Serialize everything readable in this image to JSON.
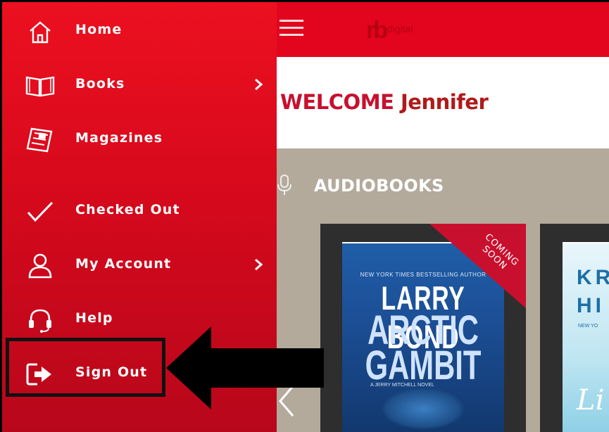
{
  "header": {
    "logo_mark": "rb",
    "logo_text": "digital"
  },
  "welcome": {
    "prefix": "WELCOME",
    "name": "Jennifer"
  },
  "section": {
    "title": "AUDIOBOOKS",
    "icon": "microphone-icon"
  },
  "books": [
    {
      "top_line": "NEW YORK TIMES BESTSELLING AUTHOR",
      "author": "LARRY BOND",
      "title_line1": "ARCTIC",
      "title_line2": "GAMBIT",
      "subtitle": "A JERRY MITCHELL NOVEL",
      "ribbon": "COMING SOON"
    },
    {
      "author_partial1": "KR",
      "author_partial2": "HI",
      "top_line": "NEW YO",
      "title_partial": "Li"
    }
  ],
  "drawer": {
    "items": [
      {
        "label": "Home",
        "icon": "home-icon",
        "has_chevron": false
      },
      {
        "label": "Books",
        "icon": "book-icon",
        "has_chevron": true
      },
      {
        "label": "Magazines",
        "icon": "magazine-icon",
        "has_chevron": false
      },
      {
        "label": "Checked Out",
        "icon": "checkmark-icon",
        "has_chevron": false
      },
      {
        "label": "My Account",
        "icon": "user-icon",
        "has_chevron": true
      },
      {
        "label": "Help",
        "icon": "headset-icon",
        "has_chevron": false
      },
      {
        "label": "Sign Out",
        "icon": "sign-out-icon",
        "has_chevron": false
      }
    ]
  },
  "colors": {
    "brand_red": "#e3051d",
    "drawer_top": "#ec1020",
    "drawer_bottom": "#b8071b",
    "shelf": "#b3aa9c",
    "annotation": "#111111"
  }
}
